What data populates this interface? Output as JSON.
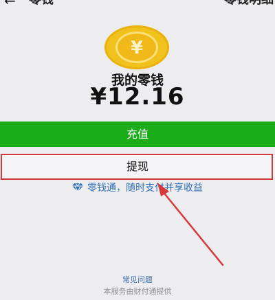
{
  "header": {
    "back_icon": "back-arrow-icon",
    "back_glyph": "←",
    "title": "零钱",
    "link": "零钱明细"
  },
  "wallet": {
    "coin_icon": "yen-coin-icon",
    "coin_symbol": "¥",
    "label": "我的零钱",
    "amount": "¥12.16"
  },
  "actions": {
    "recharge_label": "充值",
    "withdraw_label": "提现"
  },
  "promo": {
    "icon": "diamond-icon",
    "text": "零钱通，随时支付并享收益"
  },
  "footer": {
    "faq_link": "常见问题",
    "note": "本服务由财付通提供"
  },
  "colors": {
    "recharge_green": "#1aad19",
    "highlight_red": "#d43a3c",
    "coin_gold": "#f1c21d",
    "link_blue": "#2e6fb8"
  }
}
